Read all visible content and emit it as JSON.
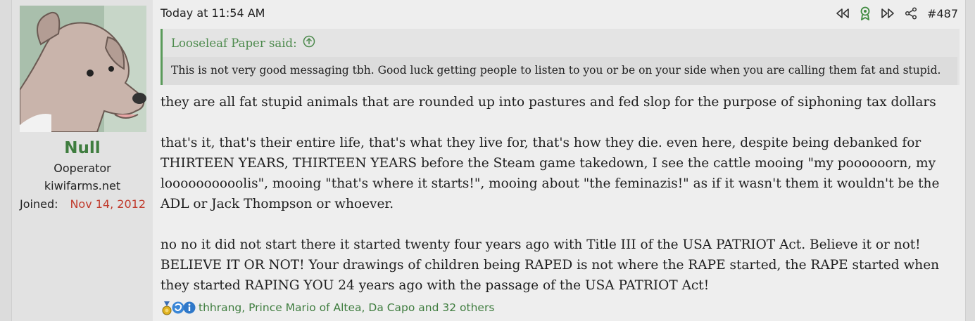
{
  "user": {
    "name": "Null",
    "title": "Ooperator",
    "site": "kiwifarms.net",
    "joined_label": "Joined:",
    "joined_value": "Nov 14, 2012"
  },
  "post": {
    "date": "Today at 11:54 AM",
    "number": "#487",
    "actions": [
      "rewind-icon",
      "award-icon",
      "fast-forward-icon",
      "share-icon"
    ],
    "quote": {
      "author": "Looseleaf Paper said:",
      "text": "This is not very good messaging tbh. Good luck getting people to listen to you or be on your side when you are calling them fat and stupid."
    },
    "paragraphs": [
      "they are all fat stupid animals that are rounded up into pastures and fed slop for the purpose of siphoning tax dollars",
      "that's it, that's their entire life, that's what they live for, that's how they die. even here, despite being debanked for THIRTEEN YEARS, THIRTEEN YEARS before the Steam game takedown, I see the cattle mooing \"my poooooorn, my loooooooooolis\", mooing \"that's where it starts!\", mooing about \"the feminazis!\" as if it wasn't them it wouldn't be the ADL or Jack Thompson or whoever.",
      "no no it did not start there it started twenty four years ago with Title III of the USA PATRIOT Act. Believe it or not! BELIEVE IT OR NOT! Your drawings of children being RAPED is not where the RAPE started, the RAPE started when they started RAPING YOU 24 years ago with the passage of the USA PATRIOT Act!"
    ],
    "reactions": {
      "icons": [
        "medal-icon",
        "winner-icon",
        "informative-icon"
      ],
      "names": "thhrang, Prince Mario of Altea, Da Capo and 32 others"
    }
  },
  "colors": {
    "accent_green": "#3f7d3f",
    "joined_red": "#c0392b"
  }
}
